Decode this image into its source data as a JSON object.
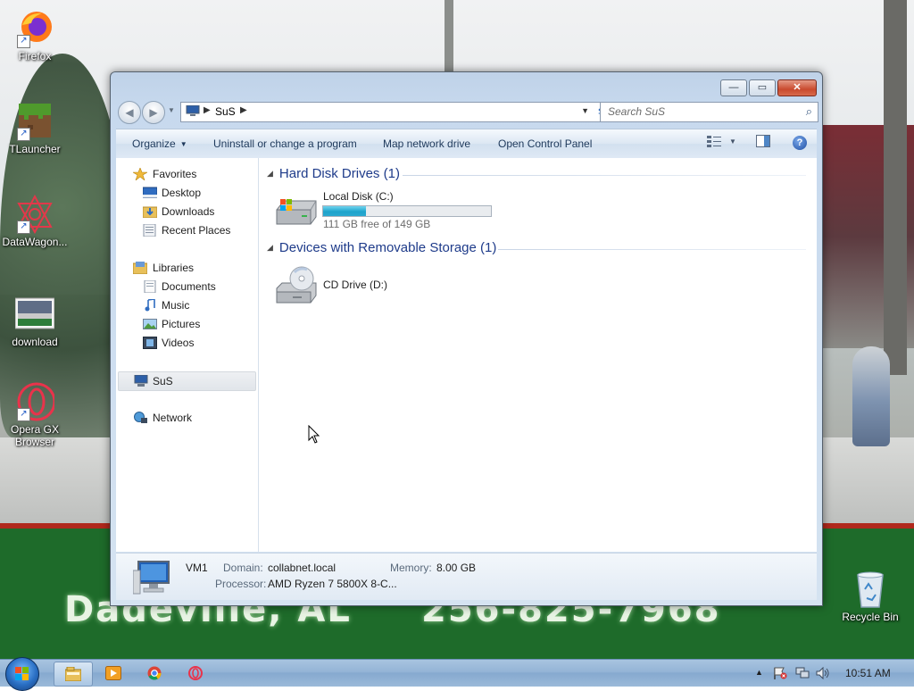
{
  "desktop": {
    "icons": [
      {
        "label": "Firefox",
        "icon": "firefox-icon"
      },
      {
        "label": "TLauncher",
        "icon": "minecraft-grass-block-icon"
      },
      {
        "label": "DataWagon...",
        "icon": "datawagon-icon"
      },
      {
        "label": "download",
        "icon": "image-file-icon"
      },
      {
        "label": "Opera GX Browser",
        "icon": "opera-gx-icon"
      },
      {
        "label": "Recycle Bin",
        "icon": "recycle-bin-icon"
      }
    ],
    "billboard": {
      "left_text": "Dadeville, AL",
      "right_text": "256-825-7968"
    }
  },
  "window": {
    "address": {
      "segments": [
        "SuS"
      ],
      "icon": "computer-icon"
    },
    "search_placeholder": "Search SuS",
    "toolbar": {
      "organize": "Organize",
      "uninstall": "Uninstall or change a program",
      "map_drive": "Map network drive",
      "control_panel": "Open Control Panel"
    },
    "nav": {
      "favorites": "Favorites",
      "desktop": "Desktop",
      "downloads": "Downloads",
      "recent": "Recent Places",
      "libraries": "Libraries",
      "documents": "Documents",
      "music": "Music",
      "pictures": "Pictures",
      "videos": "Videos",
      "computer": "SuS",
      "network": "Network"
    },
    "groups": {
      "hdd": {
        "title": "Hard Disk Drives (1)",
        "drive": {
          "name": "Local Disk (C:)",
          "free": "111 GB free of 149 GB",
          "used_fraction": 0.255
        }
      },
      "removable": {
        "title": "Devices with Removable Storage (1)",
        "drive": {
          "name": "CD Drive (D:)"
        }
      }
    },
    "details": {
      "name": "VM1",
      "domain_label": "Domain:",
      "domain": "collabnet.local",
      "memory_label": "Memory:",
      "memory": "8.00 GB",
      "processor_label": "Processor:",
      "processor": "AMD Ryzen 7 5800X 8-C..."
    }
  },
  "taskbar": {
    "clock": "10:51 AM",
    "pinned": [
      "windows-explorer-icon",
      "media-player-icon",
      "chrome-icon",
      "opera-icon"
    ]
  },
  "colors": {
    "accent": "#1e3b8a",
    "titlebar": "#bfd2e8",
    "taskbar": "#94b4d6",
    "billboard": "#1e6b2a"
  }
}
